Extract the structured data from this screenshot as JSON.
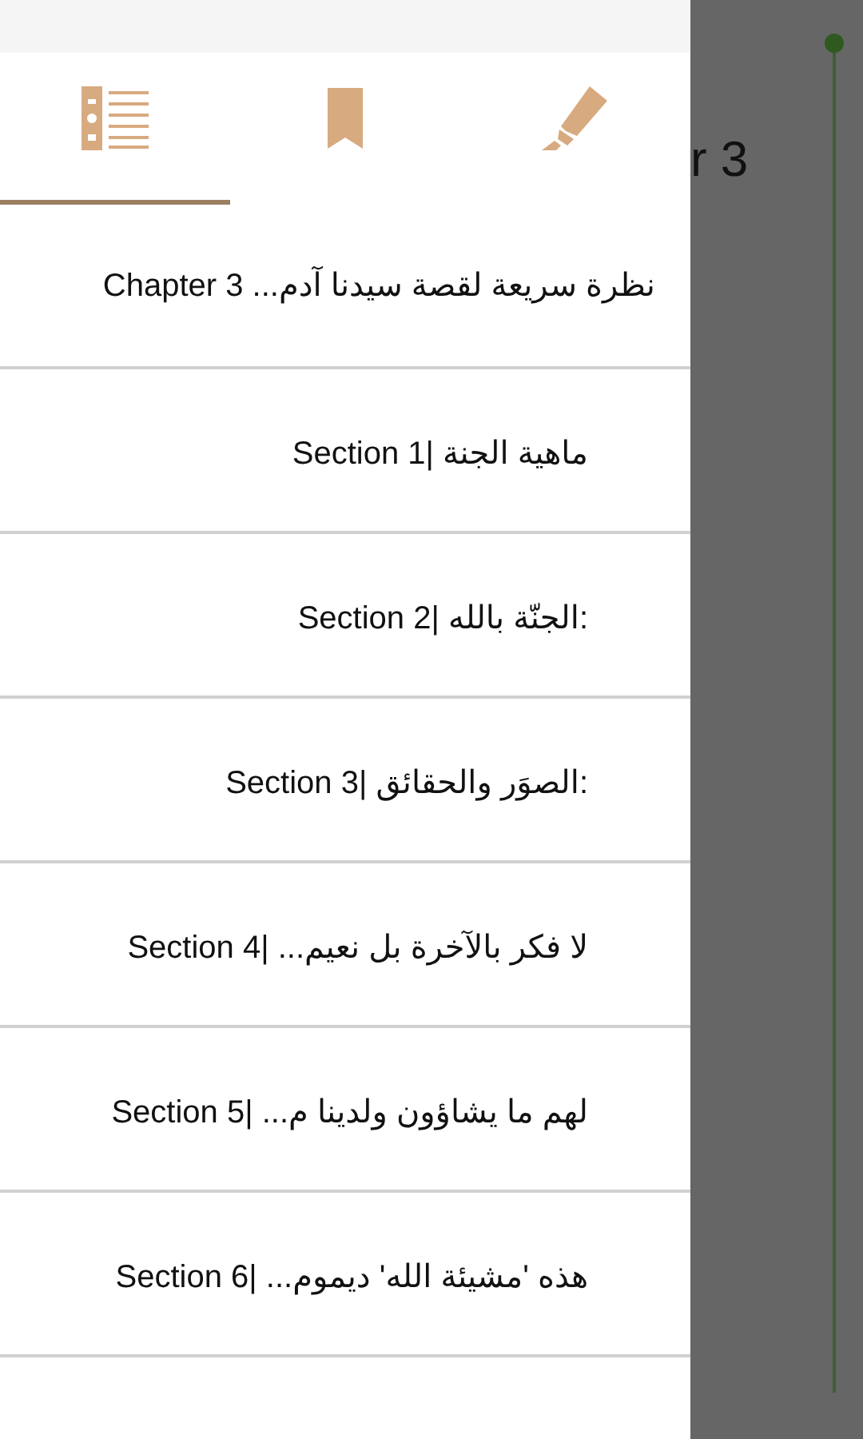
{
  "page": {
    "title": "r 3"
  },
  "drawer": {
    "tabs": [
      {
        "kind": "contents",
        "selected": true
      },
      {
        "kind": "bookmark",
        "selected": false
      },
      {
        "kind": "highlight",
        "selected": false
      }
    ],
    "items": [
      {
        "kind": "chapter",
        "text": "نظرة سريعة لقصة سيدنا آدم... Chapter 3"
      },
      {
        "kind": "section",
        "text": "ماهية الجنة |Section 1"
      },
      {
        "kind": "section",
        "text": ":الجنّة بالله |Section 2"
      },
      {
        "kind": "section",
        "text": ":الصوَر والحقائق |Section 3"
      },
      {
        "kind": "section",
        "text": "لا فكر بالآخرة بل نعيم... |Section 4"
      },
      {
        "kind": "section",
        "text": "لهم ما يشاؤون ولدينا م... |Section 5"
      },
      {
        "kind": "section",
        "text": "هذه 'مشيئة الله' ديموم... |Section 6"
      }
    ]
  }
}
